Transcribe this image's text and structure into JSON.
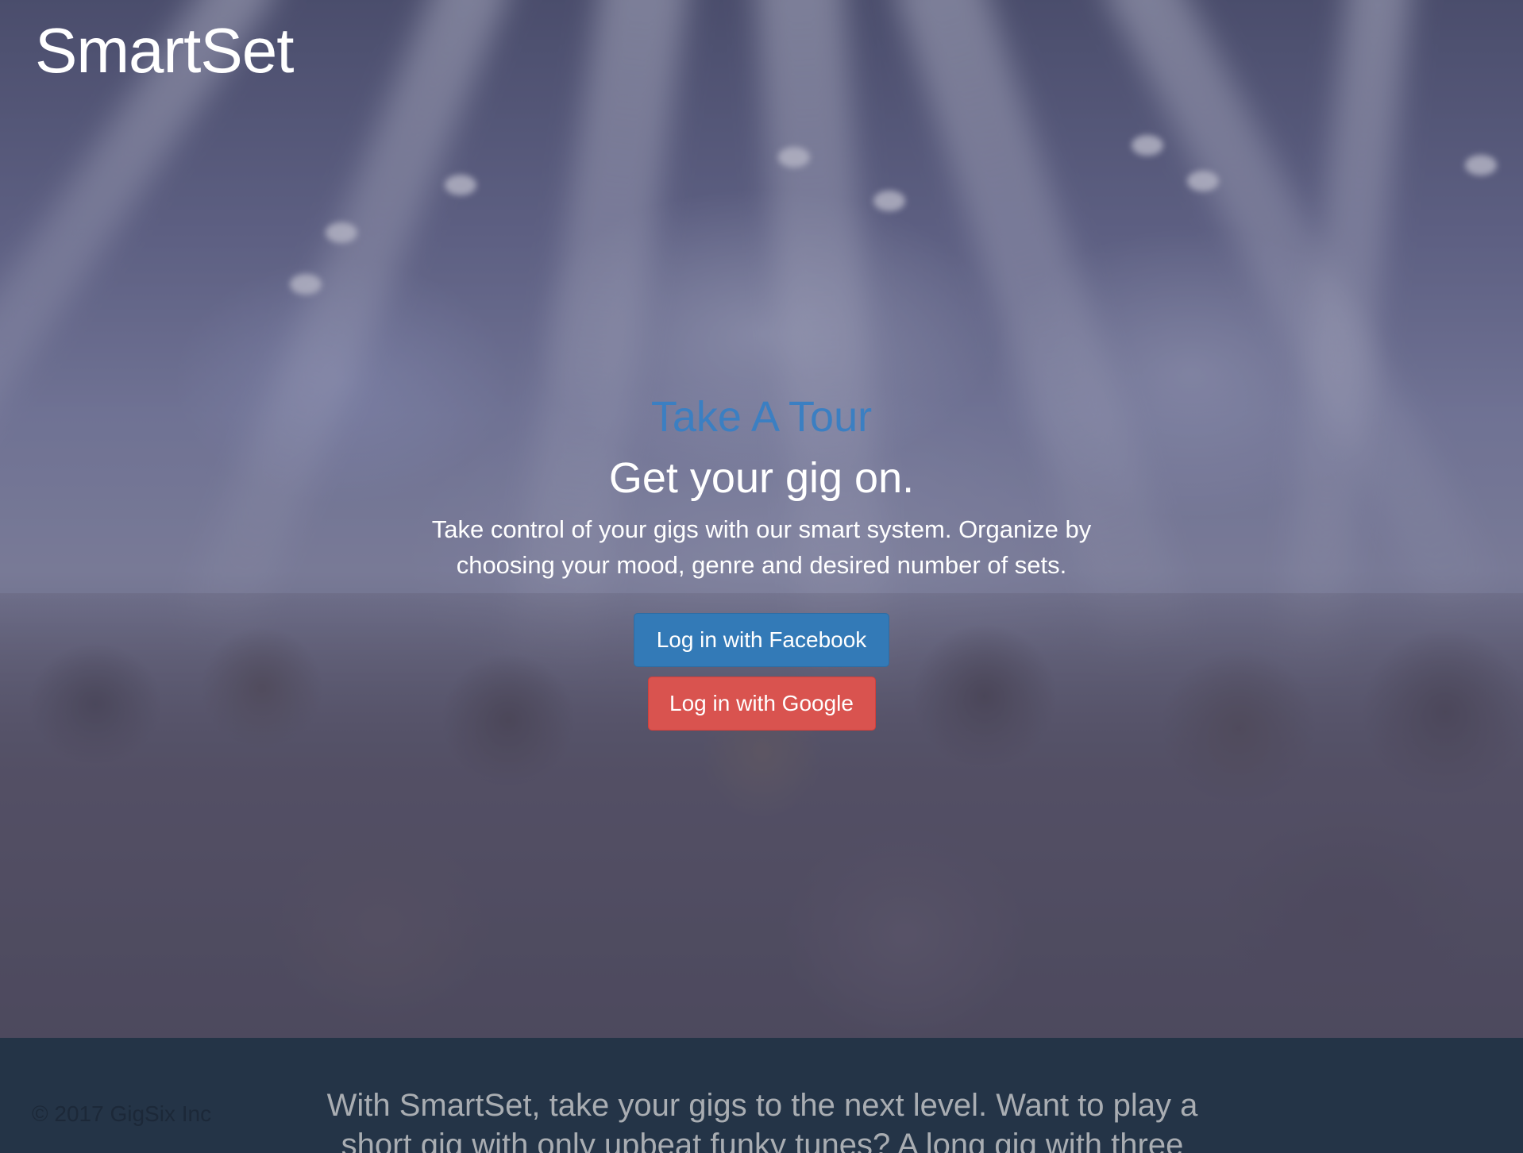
{
  "header": {
    "brand": "SmartSet"
  },
  "hero": {
    "tour_link": "Take A Tour",
    "headline": "Get your gig on.",
    "description": "Take control of your gigs with our smart system. Organize by choosing your mood, genre and desired number of sets.",
    "facebook_button": "Log in with Facebook",
    "google_button": "Log in with Google"
  },
  "footer": {
    "copyright": "© 2017 GigSix Inc",
    "intro": "With SmartSet, take your gigs to the next level. Want to play a short gig with only upbeat funky tunes? A long gig with three"
  },
  "colors": {
    "brand_text": "#ffffff",
    "tour_link": "#3b7fc2",
    "facebook_button": "#337ab7",
    "google_button": "#d9534f",
    "footer_bg": "#243447"
  }
}
